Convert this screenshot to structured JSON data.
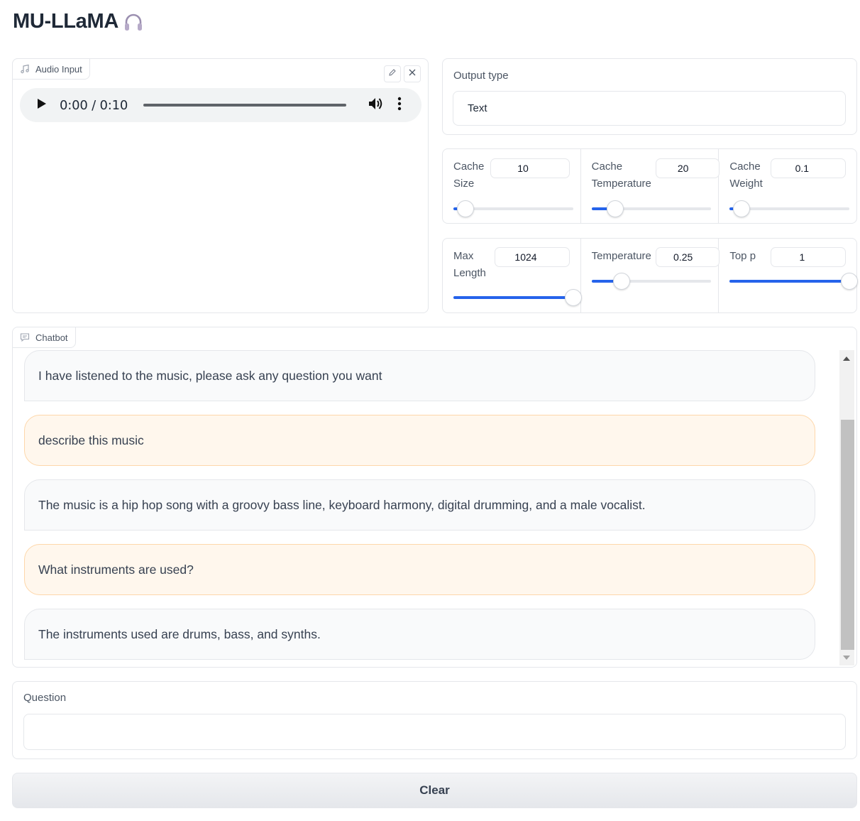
{
  "app": {
    "title": "MU-LLaMA"
  },
  "audio": {
    "label": "Audio Input",
    "time": "0:00 / 0:10",
    "progress": 0
  },
  "output": {
    "label": "Output type",
    "value": "Text"
  },
  "cache_sliders": [
    {
      "label": "Cache Size",
      "value": "10",
      "fraction": 0.1
    },
    {
      "label": "Cache Temperature",
      "value": "20",
      "fraction": 0.2
    },
    {
      "label": "Cache Weight",
      "value": "0.1",
      "fraction": 0.1
    }
  ],
  "gen_sliders": [
    {
      "label": "Max Length",
      "value": "1024",
      "fraction": 1.0
    },
    {
      "label": "Temperature",
      "value": "0.25",
      "fraction": 0.25
    },
    {
      "label": "Top p",
      "value": "1",
      "fraction": 1.0
    }
  ],
  "chatbot": {
    "label": "Chatbot",
    "messages": [
      {
        "role": "bot",
        "text": "I have listened to the music, please ask any question you want"
      },
      {
        "role": "user",
        "text": "describe this music"
      },
      {
        "role": "bot",
        "text": "The music is a hip hop song with a groovy bass line, keyboard harmony, digital drumming, and a male vocalist."
      },
      {
        "role": "user",
        "text": "What instruments are used?"
      },
      {
        "role": "bot",
        "text": "The instruments used are drums, bass, and synths."
      }
    ]
  },
  "question": {
    "label": "Question",
    "value": "",
    "placeholder": ""
  },
  "clear_button": {
    "label": "Clear"
  },
  "colors": {
    "accent": "#2563eb",
    "user_bubble": "#fff7ed",
    "bot_bubble": "#f9fafb"
  }
}
